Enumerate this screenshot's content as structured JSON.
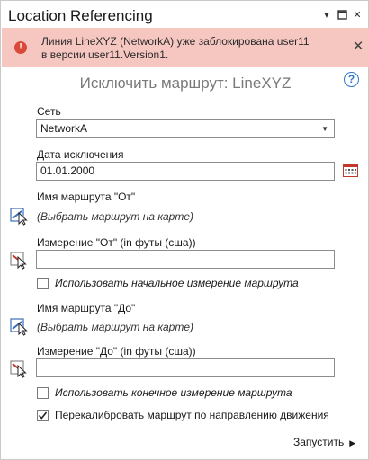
{
  "window": {
    "title": "Location Referencing",
    "menu_icon": "chevron-down-icon",
    "restore_icon": "maximize-icon",
    "close_icon": "close-icon"
  },
  "banner": {
    "line1": "Линия LineXYZ (NetworkA) уже заблокирована user11",
    "line2": "в версии  user11.Version1.",
    "icon": "error-icon",
    "close_icon": "close-icon",
    "color": "#f6c6c1"
  },
  "tool": {
    "title": "Исключить маршрут: LineXYZ",
    "help": "?"
  },
  "network": {
    "label": "Сеть",
    "value": "NetworkA"
  },
  "retire_date": {
    "label": "Дата исключения",
    "value": "01.01.2000"
  },
  "from_route": {
    "label": "Имя маршрута \"От\"",
    "hint": "(Выбрать маршрут на карте)"
  },
  "from_measure": {
    "label": "Измерение \"От\" (in футы (сша))",
    "value": ""
  },
  "use_start_measure": {
    "label": "Использовать начальное измерение маршрута",
    "checked": false
  },
  "to_route": {
    "label": "Имя маршрута \"До\"",
    "hint": "(Выбрать маршрут на карте)"
  },
  "to_measure": {
    "label": "Измерение \"До\" (in футы (сша))",
    "value": ""
  },
  "use_end_measure": {
    "label": "Использовать конечное измерение маршрута",
    "checked": false
  },
  "recalibrate": {
    "label": "Перекалибровать маршрут по направлению движения",
    "checked": true
  },
  "run": {
    "label": "Запустить"
  }
}
